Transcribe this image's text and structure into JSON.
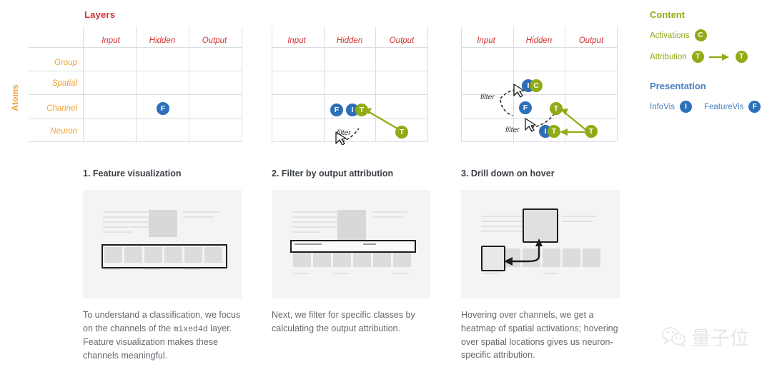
{
  "matrix": {
    "title": "Layers",
    "y_axis_label": "Atoms",
    "columns": [
      "Input",
      "Hidden",
      "Output"
    ],
    "rows": [
      "Group",
      "Spatial",
      "Channel",
      "Neuron"
    ],
    "filter_label": "filter"
  },
  "badges": {
    "F": "F",
    "I": "I",
    "T": "T",
    "C": "C"
  },
  "legend": {
    "content_heading": "Content",
    "activations_label": "Activations",
    "activations_badge": "C",
    "attribution_label": "Attribution",
    "attribution_badge_from": "T",
    "attribution_badge_to": "T",
    "presentation_heading": "Presentation",
    "infovis_label": "InfoVis",
    "infovis_badge": "I",
    "featurevis_label": "FeatureVis",
    "featurevis_badge": "F"
  },
  "colors": {
    "title_red": "#d33232",
    "atoms_orange": "#f0a030",
    "badge_blue": "#2d6fb8",
    "badge_green": "#8fab16",
    "presentation_blue": "#4a7fc1",
    "grid_line": "#d9dee3",
    "body_text": "#64696e",
    "card_title": "#3a3f45"
  },
  "cards": [
    {
      "title": "1. Feature visualization",
      "body_1": "To understand a classification, we focus on the channels of the ",
      "body_code": "mixed4d",
      "body_2": " layer. Feature visualization makes these channels meaningful."
    },
    {
      "title": "2. Filter by output attribution",
      "body_1": "Next, we filter for specific classes by calculating the output attribution.",
      "body_code": "",
      "body_2": ""
    },
    {
      "title": "3. Drill down on hover",
      "body_1": "Hovering over channels, we get a heatmap of spatial activations; hovering over spatial locations gives us neuron-specific attribution.",
      "body_code": "",
      "body_2": ""
    }
  ],
  "watermark": {
    "text": "量子位"
  }
}
